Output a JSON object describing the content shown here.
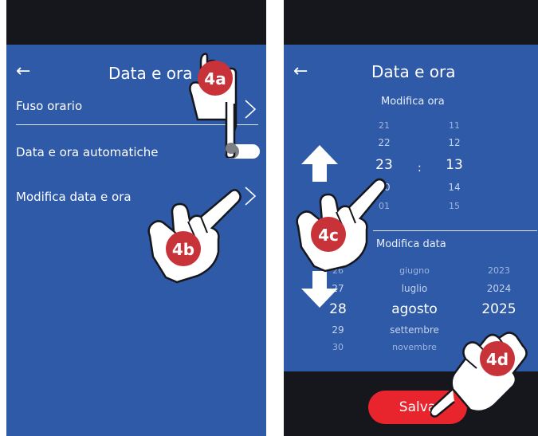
{
  "screen1": {
    "back_icon": "←",
    "title": "Data e ora",
    "rows": [
      {
        "label": "Fuso orario"
      },
      {
        "label": "Data e ora automatiche"
      },
      {
        "label": "Modifica data e ora"
      }
    ],
    "toggle_on": false
  },
  "screen2": {
    "back_icon": "←",
    "title": "Data e ora",
    "time_section": "Modifica ora",
    "hours": [
      "21",
      "22",
      "23",
      "00",
      "01"
    ],
    "minutes": [
      "11",
      "12",
      "13",
      "14",
      "15"
    ],
    "time_separator": ":",
    "date_section": "Modifica data",
    "days": [
      "26",
      "27",
      "28",
      "29",
      "30"
    ],
    "months": [
      "giugno",
      "luglio",
      "agosto",
      "settembre",
      "novembre"
    ],
    "years": [
      "2023",
      "2024",
      "2025"
    ],
    "save_label": "Salva"
  },
  "callouts": {
    "a": "4a",
    "b": "4b",
    "c": "4c",
    "d": "4d"
  },
  "colors": {
    "screen_blue": "#2e5aa8",
    "bar_black": "#15171c",
    "save_red": "#e8242c",
    "badge_red": "#c8333a"
  }
}
